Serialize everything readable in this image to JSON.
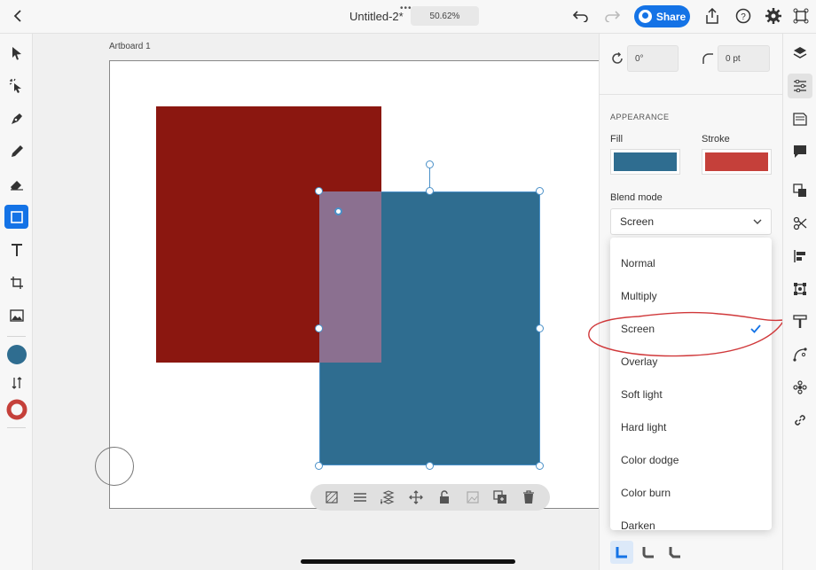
{
  "topbar": {
    "title": "Untitled-2*",
    "zoom": "50.62%",
    "share_label": "Share",
    "icons": [
      "back-chevron-icon",
      "more-dots-icon",
      "undo-icon",
      "redo-icon",
      "export-icon",
      "help-icon",
      "settings-icon",
      "collapse-icon"
    ]
  },
  "tools": [
    "select",
    "direct-select",
    "pen",
    "pencil",
    "eraser",
    "rectangle",
    "type",
    "transform",
    "image"
  ],
  "colors": {
    "fill": "#2f6d90",
    "stroke": "#c5403a",
    "red_shape": "#8b1710",
    "overlap": "#8b7090",
    "accent": "#1473e6"
  },
  "canvas": {
    "artboard_label": "Artboard 1"
  },
  "panel": {
    "rotation": "0°",
    "corner_radius": "0 pt",
    "section_title": "APPEARANCE",
    "fill_label": "Fill",
    "stroke_label": "Stroke",
    "blend_label": "Blend mode",
    "blend_value": "Screen",
    "blend_options": [
      "Normal",
      "Multiply",
      "Screen",
      "Overlay",
      "Soft light",
      "Hard light",
      "Color dodge",
      "Color burn",
      "Darken"
    ],
    "blend_selected": "Screen"
  },
  "rail": [
    "layers",
    "properties",
    "libraries",
    "comments",
    "arrange",
    "pathfinder",
    "align",
    "transform-alt",
    "type-alt",
    "path",
    "repeat",
    "link"
  ]
}
